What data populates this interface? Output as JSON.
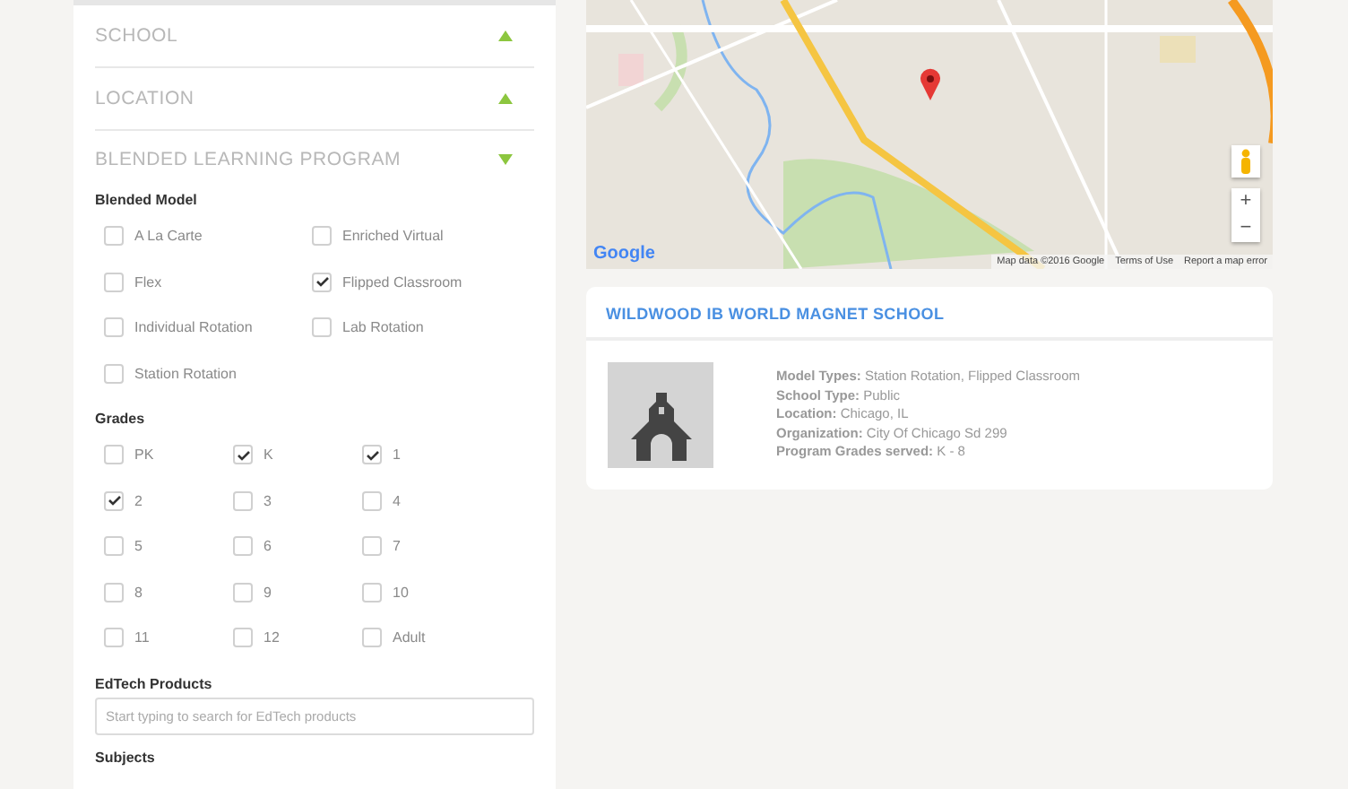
{
  "filters": {
    "sections": [
      {
        "title": "SCHOOL",
        "expanded": false
      },
      {
        "title": "LOCATION",
        "expanded": false
      },
      {
        "title": "BLENDED LEARNING PROGRAM",
        "expanded": true
      }
    ],
    "blended_model": {
      "label": "Blended Model",
      "options": [
        {
          "label": "A La Carte",
          "checked": false
        },
        {
          "label": "Enriched Virtual",
          "checked": false
        },
        {
          "label": "Flex",
          "checked": false
        },
        {
          "label": "Flipped Classroom",
          "checked": true
        },
        {
          "label": "Individual Rotation",
          "checked": false
        },
        {
          "label": "Lab Rotation",
          "checked": false
        },
        {
          "label": "Station Rotation",
          "checked": false
        }
      ]
    },
    "grades": {
      "label": "Grades",
      "options": [
        {
          "label": "PK",
          "checked": false
        },
        {
          "label": "K",
          "checked": true
        },
        {
          "label": "1",
          "checked": true
        },
        {
          "label": "2",
          "checked": true
        },
        {
          "label": "3",
          "checked": false
        },
        {
          "label": "4",
          "checked": false
        },
        {
          "label": "5",
          "checked": false
        },
        {
          "label": "6",
          "checked": false
        },
        {
          "label": "7",
          "checked": false
        },
        {
          "label": "8",
          "checked": false
        },
        {
          "label": "9",
          "checked": false
        },
        {
          "label": "10",
          "checked": false
        },
        {
          "label": "11",
          "checked": false
        },
        {
          "label": "12",
          "checked": false
        },
        {
          "label": "Adult",
          "checked": false
        }
      ]
    },
    "edtech": {
      "label": "EdTech Products",
      "placeholder": "Start typing to search for EdTech products"
    },
    "subjects": {
      "label": "Subjects"
    }
  },
  "map": {
    "logo": "Google",
    "attribution": [
      "Map data ©2016 Google",
      "Terms of Use",
      "Report a map error"
    ],
    "zoom_in": "+",
    "zoom_out": "−"
  },
  "school_card": {
    "title": "WILDWOOD IB WORLD MAGNET SCHOOL",
    "details": [
      "**Model Types:** Station Rotation, Flipped Classroom",
      "**School Type:** Public",
      "**Location:** Chicago, IL",
      "**Organization:** City Of Chicago Sd 299",
      "**Program Grades served:** K - 8"
    ]
  }
}
